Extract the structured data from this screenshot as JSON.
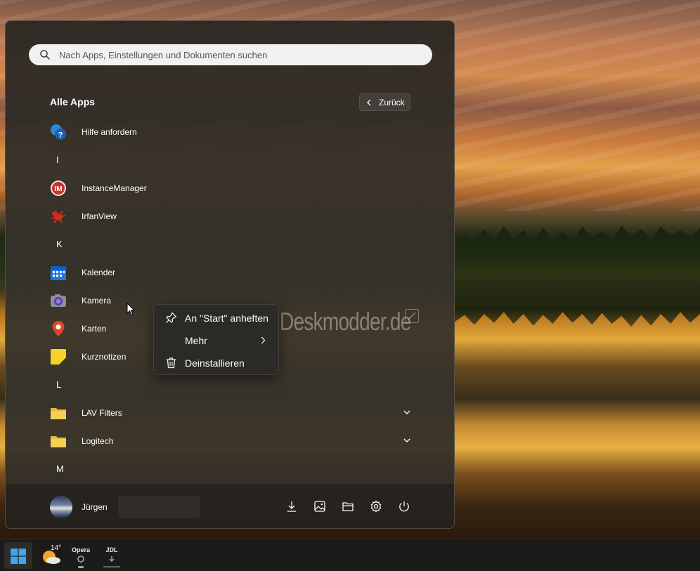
{
  "search": {
    "placeholder": "Nach Apps, Einstellungen und Dokumenten suchen"
  },
  "all_apps": {
    "title": "Alle Apps",
    "back_label": "Zurück",
    "items": [
      {
        "type": "app",
        "label": "Hilfe anfordern",
        "icon": "help-icon"
      },
      {
        "type": "letter",
        "label": "I"
      },
      {
        "type": "app",
        "label": "InstanceManager",
        "icon": "instancemanager-icon"
      },
      {
        "type": "app",
        "label": "IrfanView",
        "icon": "irfanview-icon"
      },
      {
        "type": "letter",
        "label": "K"
      },
      {
        "type": "app",
        "label": "Kalender",
        "icon": "calendar-icon"
      },
      {
        "type": "app",
        "label": "Kamera",
        "icon": "camera-icon"
      },
      {
        "type": "app",
        "label": "Karten",
        "icon": "maps-icon"
      },
      {
        "type": "app",
        "label": "Kurznotizen",
        "icon": "sticky-notes-icon"
      },
      {
        "type": "letter",
        "label": "L"
      },
      {
        "type": "folder",
        "label": "LAV Filters",
        "icon": "folder-icon"
      },
      {
        "type": "folder",
        "label": "Logitech",
        "icon": "folder-icon"
      },
      {
        "type": "letter",
        "label": "M"
      }
    ]
  },
  "context_menu": {
    "items": [
      {
        "label": "An \"Start\" anheften",
        "icon": "pin-icon"
      },
      {
        "label": "Mehr",
        "icon": "",
        "submenu": true
      },
      {
        "label": "Deinstallieren",
        "icon": "trash-icon"
      }
    ]
  },
  "user": {
    "name": "Jürgen"
  },
  "bottom_actions": [
    "downloads-icon",
    "pictures-icon",
    "file-explorer-icon",
    "settings-icon",
    "power-icon"
  ],
  "watermark": "Deskmodder.de",
  "taskbar": {
    "weather_temp": "14°",
    "apps": [
      {
        "label": "Opera",
        "icon": "opera-icon"
      },
      {
        "label": "JDL",
        "icon": "jdownloader-icon"
      }
    ]
  },
  "colors": {
    "menu_bg": "#2f2c28",
    "accent_blue": "#0078d4",
    "taskbar_bg": "#1c1b1a"
  }
}
